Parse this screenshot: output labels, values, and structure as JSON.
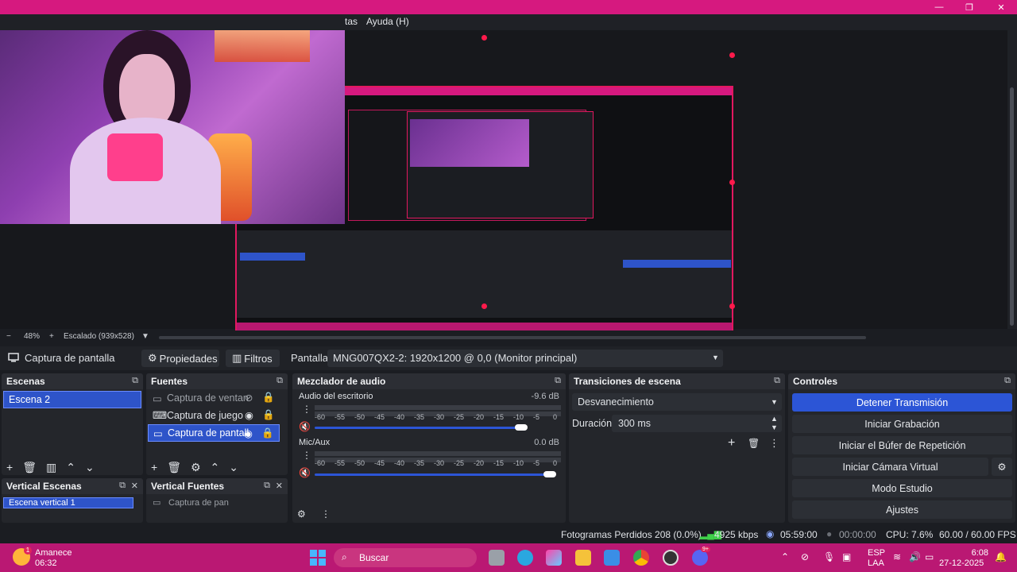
{
  "menu": {
    "items": [
      "tas",
      "Ayuda (H)"
    ]
  },
  "window_controls": {
    "minimize": "—",
    "maximize": "❐",
    "close": "✕"
  },
  "zoom": {
    "minus": "−",
    "level": "48%",
    "plus": "+",
    "scaled": "Escalado (939x528)"
  },
  "source_toolbar": {
    "source_name": "Captura de pantalla",
    "properties": "Propiedades",
    "filters": "Filtros",
    "display_label": "Pantalla",
    "display_value": "MNG007QX2-2: 1920x1200 @ 0,0 (Monitor principal)"
  },
  "scenes": {
    "title": "Escenas",
    "items": [
      "Escena 2"
    ]
  },
  "sources": {
    "title": "Fuentes",
    "items": [
      "Captura de ventan",
      "Captura de juego",
      "Captura de pantall"
    ]
  },
  "mixer": {
    "title": "Mezclador de audio",
    "channels": [
      {
        "name": "Audio del escritorio",
        "db": "-9.6 dB",
        "volume": 0.88
      },
      {
        "name": "Mic/Aux",
        "db": "0.0 dB",
        "volume": 1.0
      }
    ],
    "scale": [
      "-60",
      "-55",
      "-50",
      "-45",
      "-40",
      "-35",
      "-30",
      "-25",
      "-20",
      "-15",
      "-10",
      "-5",
      "0"
    ]
  },
  "transitions": {
    "title": "Transiciones de escena",
    "selected": "Desvanecimiento",
    "duration_label": "Duración",
    "duration_value": "300 ms"
  },
  "controls": {
    "title": "Controles",
    "buttons": [
      "Detener Transmisión",
      "Iniciar Grabación",
      "Iniciar el Búfer de Repetición",
      "Iniciar Cámara Virtual",
      "Modo Estudio",
      "Ajustes"
    ]
  },
  "vertical_scenes": {
    "title": "Vertical Escenas",
    "items": [
      "Escena vertical 1"
    ]
  },
  "vertical_sources": {
    "title": "Vertical Fuentes",
    "items": [
      "Captura de pan"
    ]
  },
  "status": {
    "dropped": "Fotogramas Perdidos 208 (0.0%)",
    "bitrate": "4925 kbps",
    "stream_time": "05:59:00",
    "rec_time": "00:00:00",
    "cpu": "CPU: 7.6%",
    "fps": "60.00 / 60.00 FPS"
  },
  "taskbar": {
    "weather_title": "Amanece",
    "weather_time": "06:32",
    "weather_badge": "1",
    "search": "Buscar",
    "lang": "ESP",
    "lang2": "LAA",
    "clock_time": "6:08",
    "clock_date": "27-12-2025",
    "discord_badge": "9+"
  }
}
